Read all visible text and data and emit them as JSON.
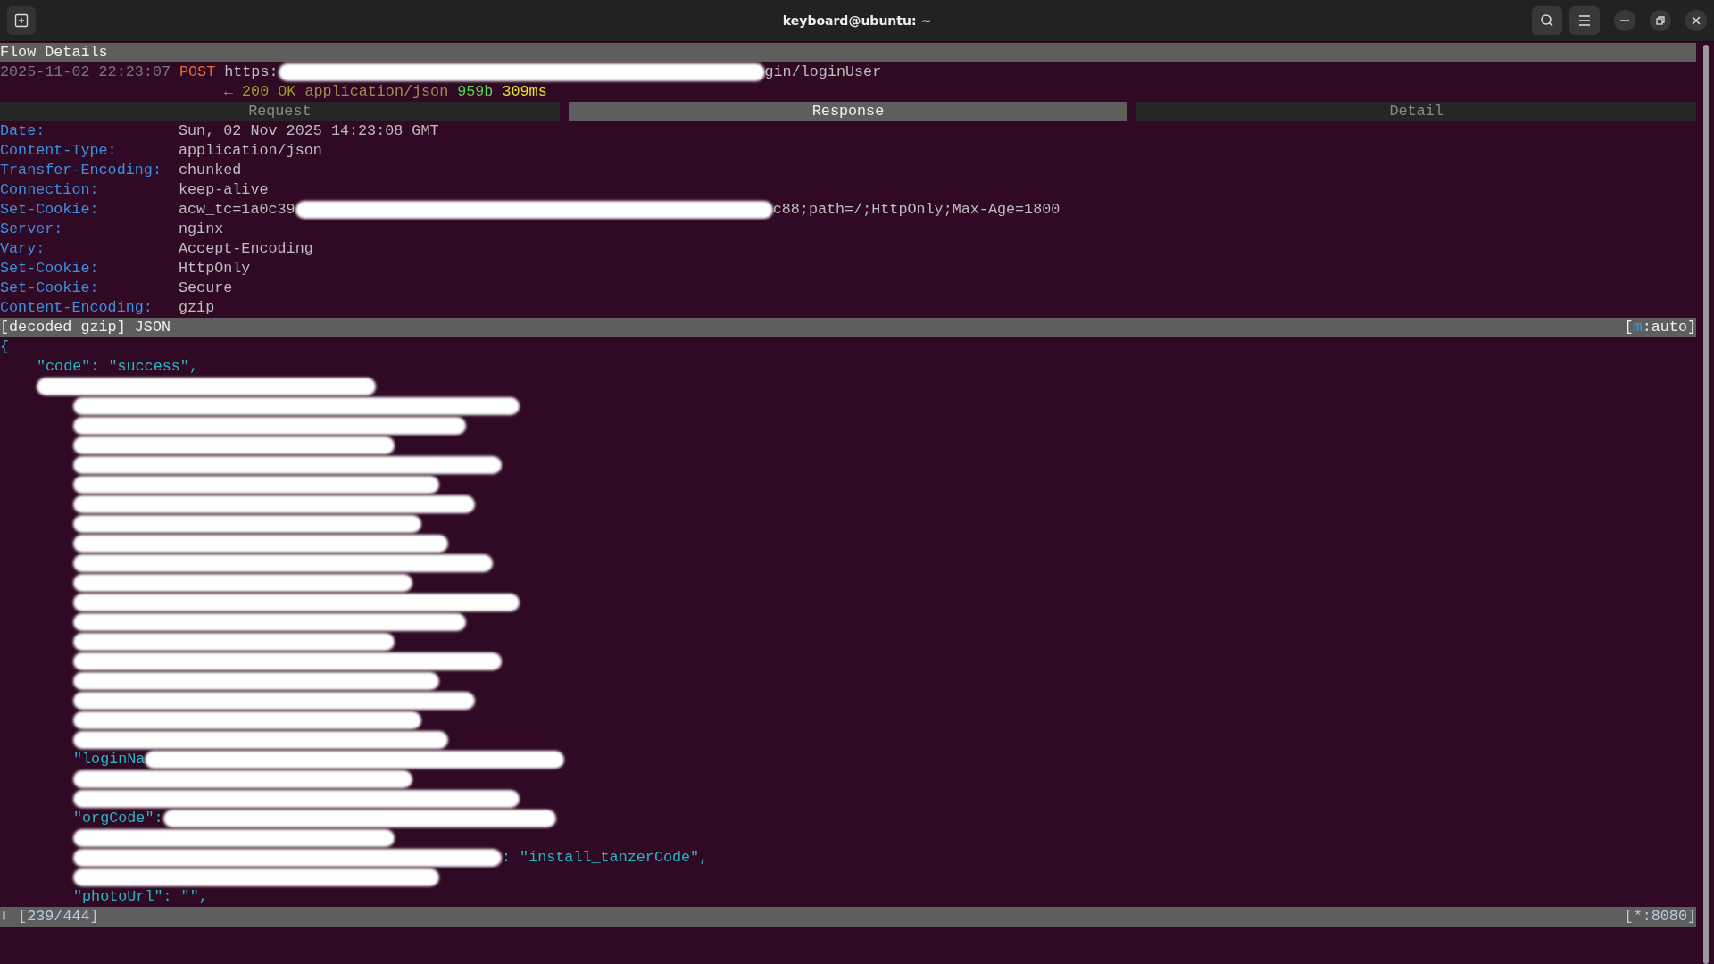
{
  "window": {
    "title": "keyboard@ubuntu: ~"
  },
  "panel_title": "Flow Details",
  "request": {
    "timestamp": "2025-11-02 22:23:07",
    "method": "POST",
    "url_head": "https:",
    "url_tail": "gin/loginUser",
    "redacted": true
  },
  "response": {
    "arrow": "←",
    "status": "200 OK",
    "content_type": "application/json",
    "size": "959b",
    "duration": "309ms"
  },
  "tabs": [
    {
      "label": "Request",
      "selected": false
    },
    {
      "label": "Response",
      "selected": true
    },
    {
      "label": "Detail",
      "selected": false
    }
  ],
  "headers": [
    {
      "name": "Date:",
      "value": "Sun, 02 Nov 2025 14:23:08 GMT"
    },
    {
      "name": "Content-Type:",
      "value": "application/json"
    },
    {
      "name": "Transfer-Encoding:",
      "value": "chunked"
    },
    {
      "name": "Connection:",
      "value": "keep-alive"
    },
    {
      "name": "Set-Cookie:",
      "value": "acw_tc=1a0c39",
      "tail": "c88;path=/;HttpOnly;Max-Age=1800",
      "redacted": true
    },
    {
      "name": "Server:",
      "value": "nginx"
    },
    {
      "name": "Vary:",
      "value": "Accept-Encoding"
    },
    {
      "name": "Set-Cookie:",
      "value": "HttpOnly"
    },
    {
      "name": "Set-Cookie:",
      "value": "Secure"
    },
    {
      "name": "Content-Encoding:",
      "value": "gzip"
    }
  ],
  "content_bar": {
    "label": "[decoded gzip] JSON",
    "mode_open": "[",
    "mode_key": "m",
    "mode_rest": ":auto]"
  },
  "body": {
    "lines": [
      {
        "text": "{",
        "children": [
          {
            "text": "\"code\": \"success\","
          },
          {
            "redacted": true,
            "children": [
              {
                "redacted": true
              },
              {
                "redacted": true
              },
              {
                "redacted": true
              },
              {
                "redacted": true
              },
              {
                "redacted": true
              },
              {
                "redacted": true
              },
              {
                "redacted": true
              },
              {
                "redacted": true
              },
              {
                "redacted": true
              },
              {
                "redacted": true
              },
              {
                "redacted": true
              },
              {
                "redacted": true
              },
              {
                "redacted": true
              },
              {
                "redacted": true
              },
              {
                "redacted": true
              },
              {
                "redacted": true
              },
              {
                "redacted": true
              },
              {
                "redacted": true
              },
              {
                "head": "\"loginNa",
                "redacted": true
              },
              {
                "redacted": true
              },
              {
                "redacted": true
              },
              {
                "head": "\"orgCode\":",
                "redacted": true
              },
              {
                "redacted": true
              },
              {
                "tail": ": \"install_tanzerCode\",",
                "redacted": true
              },
              {
                "redacted": true
              },
              {
                "text": "\"photoUrl\": \"\","
              }
            ]
          }
        ]
      }
    ]
  },
  "status_bar": {
    "arrow": "⇩",
    "position": "[239/444]",
    "listen": "[*:8080]"
  }
}
